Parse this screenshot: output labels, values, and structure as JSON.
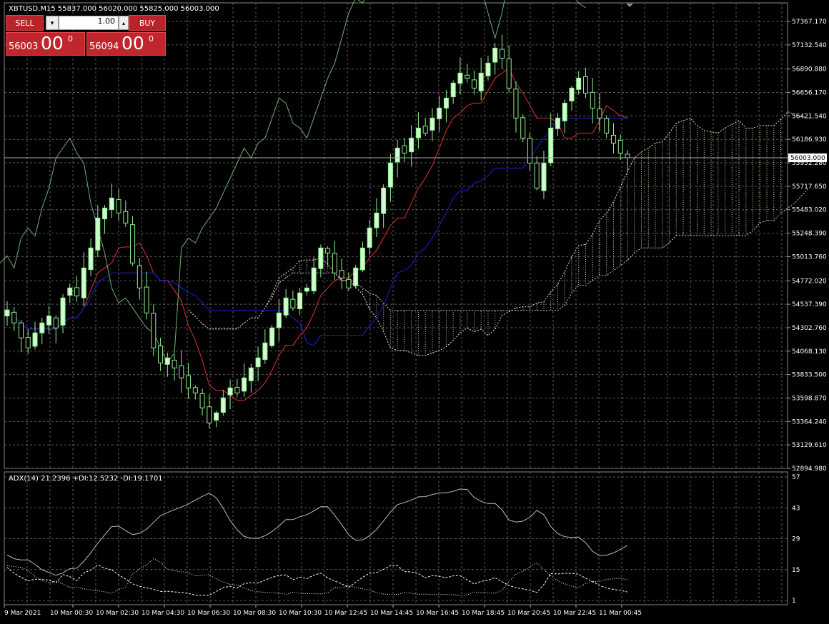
{
  "header": {
    "symbol_line": "XBTUSD,M15  55837.000 56020.000 55825.000 56003.000"
  },
  "trade_panel": {
    "sell_label": "SELL",
    "buy_label": "BUY",
    "lot_value": "1.00",
    "sell_price_small": "56003",
    "sell_price_big": "00",
    "sell_price_sup": "0",
    "buy_price_small": "56094",
    "buy_price_big": "00",
    "buy_price_sup": "0"
  },
  "colors": {
    "background": "#000000",
    "grid": "#5a5a5a",
    "candle_bull": "#ccffcc",
    "candle_bear": "#000000",
    "candle_outline": "#90ee90",
    "tenkan": "#e03030",
    "kijun": "#2020d0",
    "chikou": "#88dd88",
    "cloud_up": "#f5deb3",
    "cloud_down": "#d8bfd8",
    "adx_line": "#b0c4b0",
    "di_plus": "#ffffff",
    "di_minus": "#ffffff"
  },
  "chart_data": [
    {
      "type": "line",
      "title": "XBTUSD,M15",
      "ohlc_last": {
        "open": 55837.0,
        "high": 56020.0,
        "low": 55825.0,
        "close": 56003.0
      },
      "current_price_label": "56003.000",
      "current_price": 56003.0,
      "y_ticks": [
        "57367.170",
        "57132.540",
        "56890.880",
        "56656.170",
        "56421.540",
        "56186.930",
        "55952.280",
        "55717.650",
        "55483.020",
        "55248.390",
        "55013.760",
        "54772.020",
        "54537.390",
        "54302.760",
        "54068.130",
        "53833.500",
        "53598.870",
        "53364.240",
        "53129.610",
        "52894.980"
      ],
      "ylim": [
        52894.98,
        57367.17
      ],
      "x_ticks": [
        "9 Mar 2021",
        "10 Mar 00:30",
        "10 Mar 02:30",
        "10 Mar 04:30",
        "10 Mar 06:30",
        "10 Mar 08:30",
        "10 Mar 10:30",
        "10 Mar 12:45",
        "10 Mar 14:45",
        "10 Mar 16:45",
        "10 Mar 18:45",
        "10 Mar 20:45",
        "10 Mar 22:45",
        "11 Mar 00:45"
      ],
      "close_series": [
        54480,
        54350,
        54200,
        54100,
        54250,
        54350,
        54420,
        54300,
        54600,
        54700,
        54620,
        54900,
        55100,
        55400,
        55500,
        55600,
        55450,
        55350,
        54950,
        54700,
        54450,
        54100,
        53950,
        54000,
        53900,
        53800,
        53700,
        53650,
        53500,
        53350,
        53450,
        53600,
        53700,
        53650,
        53800,
        53900,
        54000,
        54150,
        54300,
        54450,
        54600,
        54500,
        54650,
        54700,
        54900,
        55100,
        55050,
        54850,
        54800,
        54700,
        54900,
        55100,
        55300,
        55450,
        55700,
        55950,
        56100,
        56050,
        56200,
        56300,
        56250,
        56400,
        56500,
        56600,
        56750,
        56850,
        56800,
        56700,
        56850,
        56950,
        57100,
        57000,
        56700,
        56400,
        56200,
        55950,
        55700,
        55950,
        56300,
        56400,
        56550,
        56700,
        56800,
        56650,
        56500,
        56400,
        56250,
        56150,
        56050,
        56003
      ],
      "adx_title": "ADX(14) 21.2396 +DI:12.5232 -DI:19.1701",
      "adx_y_ticks": [
        "57",
        "43",
        "29",
        "15",
        "1"
      ],
      "adx_ylim": [
        1,
        57
      ],
      "adx": {
        "value": 21.2396,
        "plus_di": 12.5232,
        "minus_di": 19.1701
      }
    }
  ]
}
